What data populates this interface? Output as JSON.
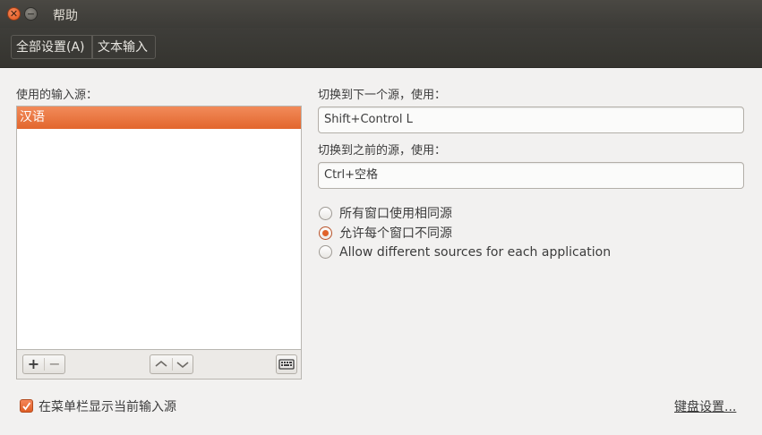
{
  "window": {
    "title": "帮助",
    "close_glyph": "✕",
    "minimize_glyph": "−"
  },
  "menubar": {
    "items": [
      {
        "label": "全部设置(A)"
      },
      {
        "label": "文本输入"
      }
    ]
  },
  "input_sources": {
    "label": "使用的输入源：",
    "items": [
      {
        "label": "汉语",
        "selected": true
      }
    ],
    "toolbar": {
      "add": "+",
      "remove": "−",
      "up": "⌃",
      "down": "⌄",
      "keyboard_icon": "keyboard-icon"
    }
  },
  "switch_next": {
    "label": "切换到下一个源，使用：",
    "value": "Shift+Control L"
  },
  "switch_prev": {
    "label": "切换到之前的源，使用：",
    "value": "Ctrl+空格"
  },
  "source_mode": {
    "options": [
      {
        "label": "所有窗口使用相同源",
        "checked": false
      },
      {
        "label": "允许每个窗口不同源",
        "checked": true
      },
      {
        "label": "Allow different sources for each application",
        "checked": false
      }
    ]
  },
  "footer": {
    "show_in_menubar": {
      "label": "在菜单栏显示当前输入源",
      "checked": true
    },
    "keyboard_settings_link": "键盘设置..."
  },
  "colors": {
    "accent": "#e2662d",
    "titlebar": "#3c3b37",
    "background": "#f2f1f0"
  }
}
